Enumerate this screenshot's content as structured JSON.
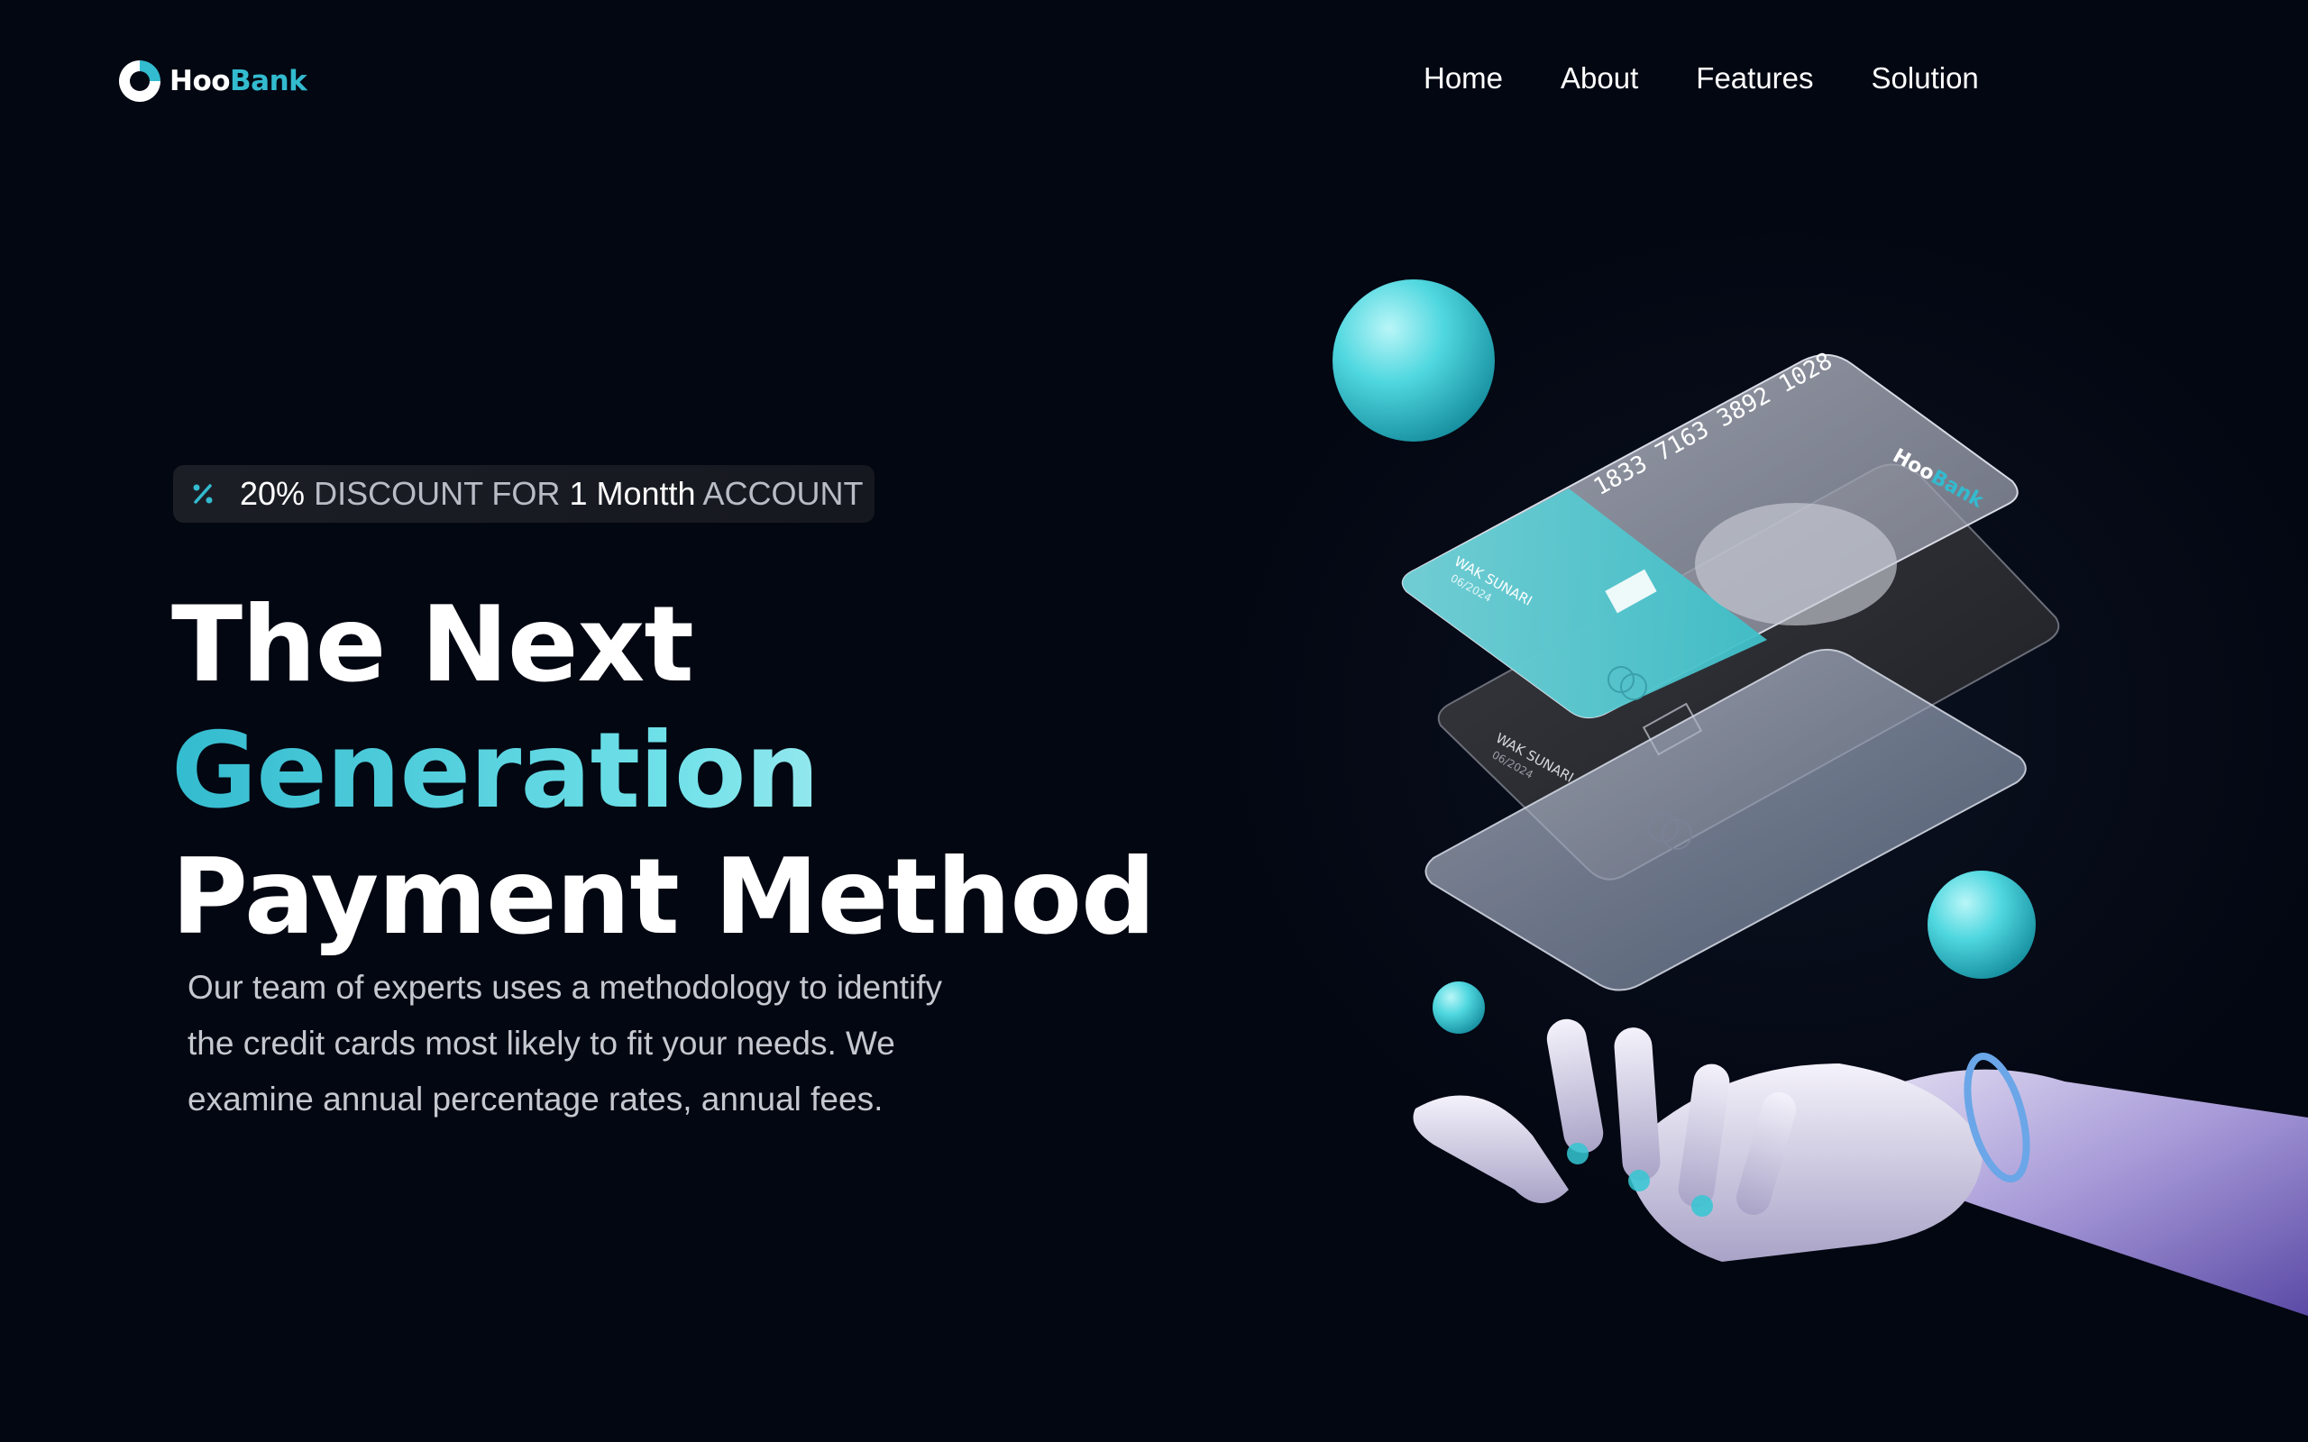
{
  "brand": {
    "name_part1": "Hoo",
    "name_part2": "Bank",
    "accent_color": "#33bbcf"
  },
  "nav": {
    "items": [
      {
        "label": "Home"
      },
      {
        "label": "About"
      },
      {
        "label": "Features"
      },
      {
        "label": "Solution"
      }
    ]
  },
  "badge": {
    "icon": "discount-icon",
    "part1": "20%",
    "part2": "DISCOUNT FOR",
    "part3": "1 Montth",
    "part4": "ACCOUNT"
  },
  "hero": {
    "line1": "The Next",
    "line2": "Generation",
    "line3": "Payment Method",
    "description": "Our team of experts uses a methodology to identify the credit cards most likely to fit your needs. We examine annual percentage rates, annual fees."
  },
  "cards": {
    "front_number": "1833 7163 3892 1028",
    "front_brand_part1": "Hoo",
    "front_brand_part2": "Bank",
    "holder": "WAK SUNARI",
    "expiry": "06/2024",
    "back_holder": "WAK SUNARI",
    "back_expiry": "06/2024"
  }
}
